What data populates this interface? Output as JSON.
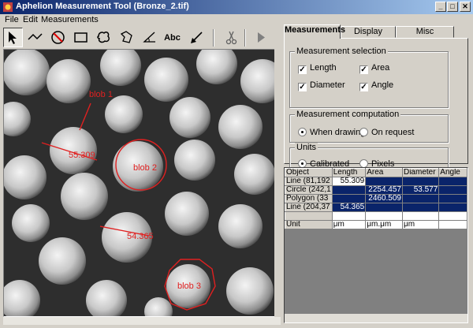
{
  "window": {
    "title": "Aphelion Measurement Tool (Bronze_2.tif)",
    "min": "_",
    "max": "□",
    "close": "✕"
  },
  "menu": [
    "File",
    "Edit",
    "Measurements"
  ],
  "toolbar": {
    "tools": [
      "pointer-icon",
      "polyline-icon",
      "no-entry-icon",
      "rectangle-icon",
      "freehand-region-icon",
      "polygon-icon",
      "angle-icon",
      "text-tool",
      "arrow-line-icon",
      "scissors-icon",
      "play-icon"
    ],
    "text_label": "Abc"
  },
  "image": {
    "annotations": [
      "blob 1",
      "blob 2",
      "blob 3"
    ],
    "line_labels": [
      "55.309",
      "54.365"
    ]
  },
  "tabs": [
    "Measurements",
    "Display",
    "Misc"
  ],
  "measurement_selection": {
    "title": "Measurement selection",
    "items": [
      {
        "label": "Length",
        "checked": true
      },
      {
        "label": "Area",
        "checked": true
      },
      {
        "label": "Diameter",
        "checked": true
      },
      {
        "label": "Angle",
        "checked": true
      }
    ]
  },
  "measurement_computation": {
    "title": "Measurement computation",
    "options": [
      {
        "label": "When drawing",
        "selected": true
      },
      {
        "label": "On request",
        "selected": false
      }
    ]
  },
  "units": {
    "title": "Units",
    "options": [
      {
        "label": "Calibrated",
        "selected": true
      },
      {
        "label": "Pixels",
        "selected": false
      }
    ]
  },
  "table": {
    "columns": [
      "Object",
      "Length",
      "Area",
      "Diameter",
      "Angle"
    ],
    "rows": [
      [
        "Line (81,192",
        "55.309",
        "",
        "",
        ""
      ],
      [
        "Circle (242,1",
        "",
        "2254.457",
        "53.577",
        ""
      ],
      [
        "Polygon (33",
        "",
        "2460.509",
        "",
        ""
      ],
      [
        "Line (204,37",
        "54.365",
        "",
        "",
        ""
      ],
      [
        "",
        "",
        "",
        "",
        ""
      ],
      [
        "Unit",
        "μm",
        "μm.μm",
        "μm",
        ""
      ]
    ]
  },
  "colors": {
    "titlebar": "#0a246a",
    "selection": "#0a246a",
    "annotation": "#e02020"
  }
}
